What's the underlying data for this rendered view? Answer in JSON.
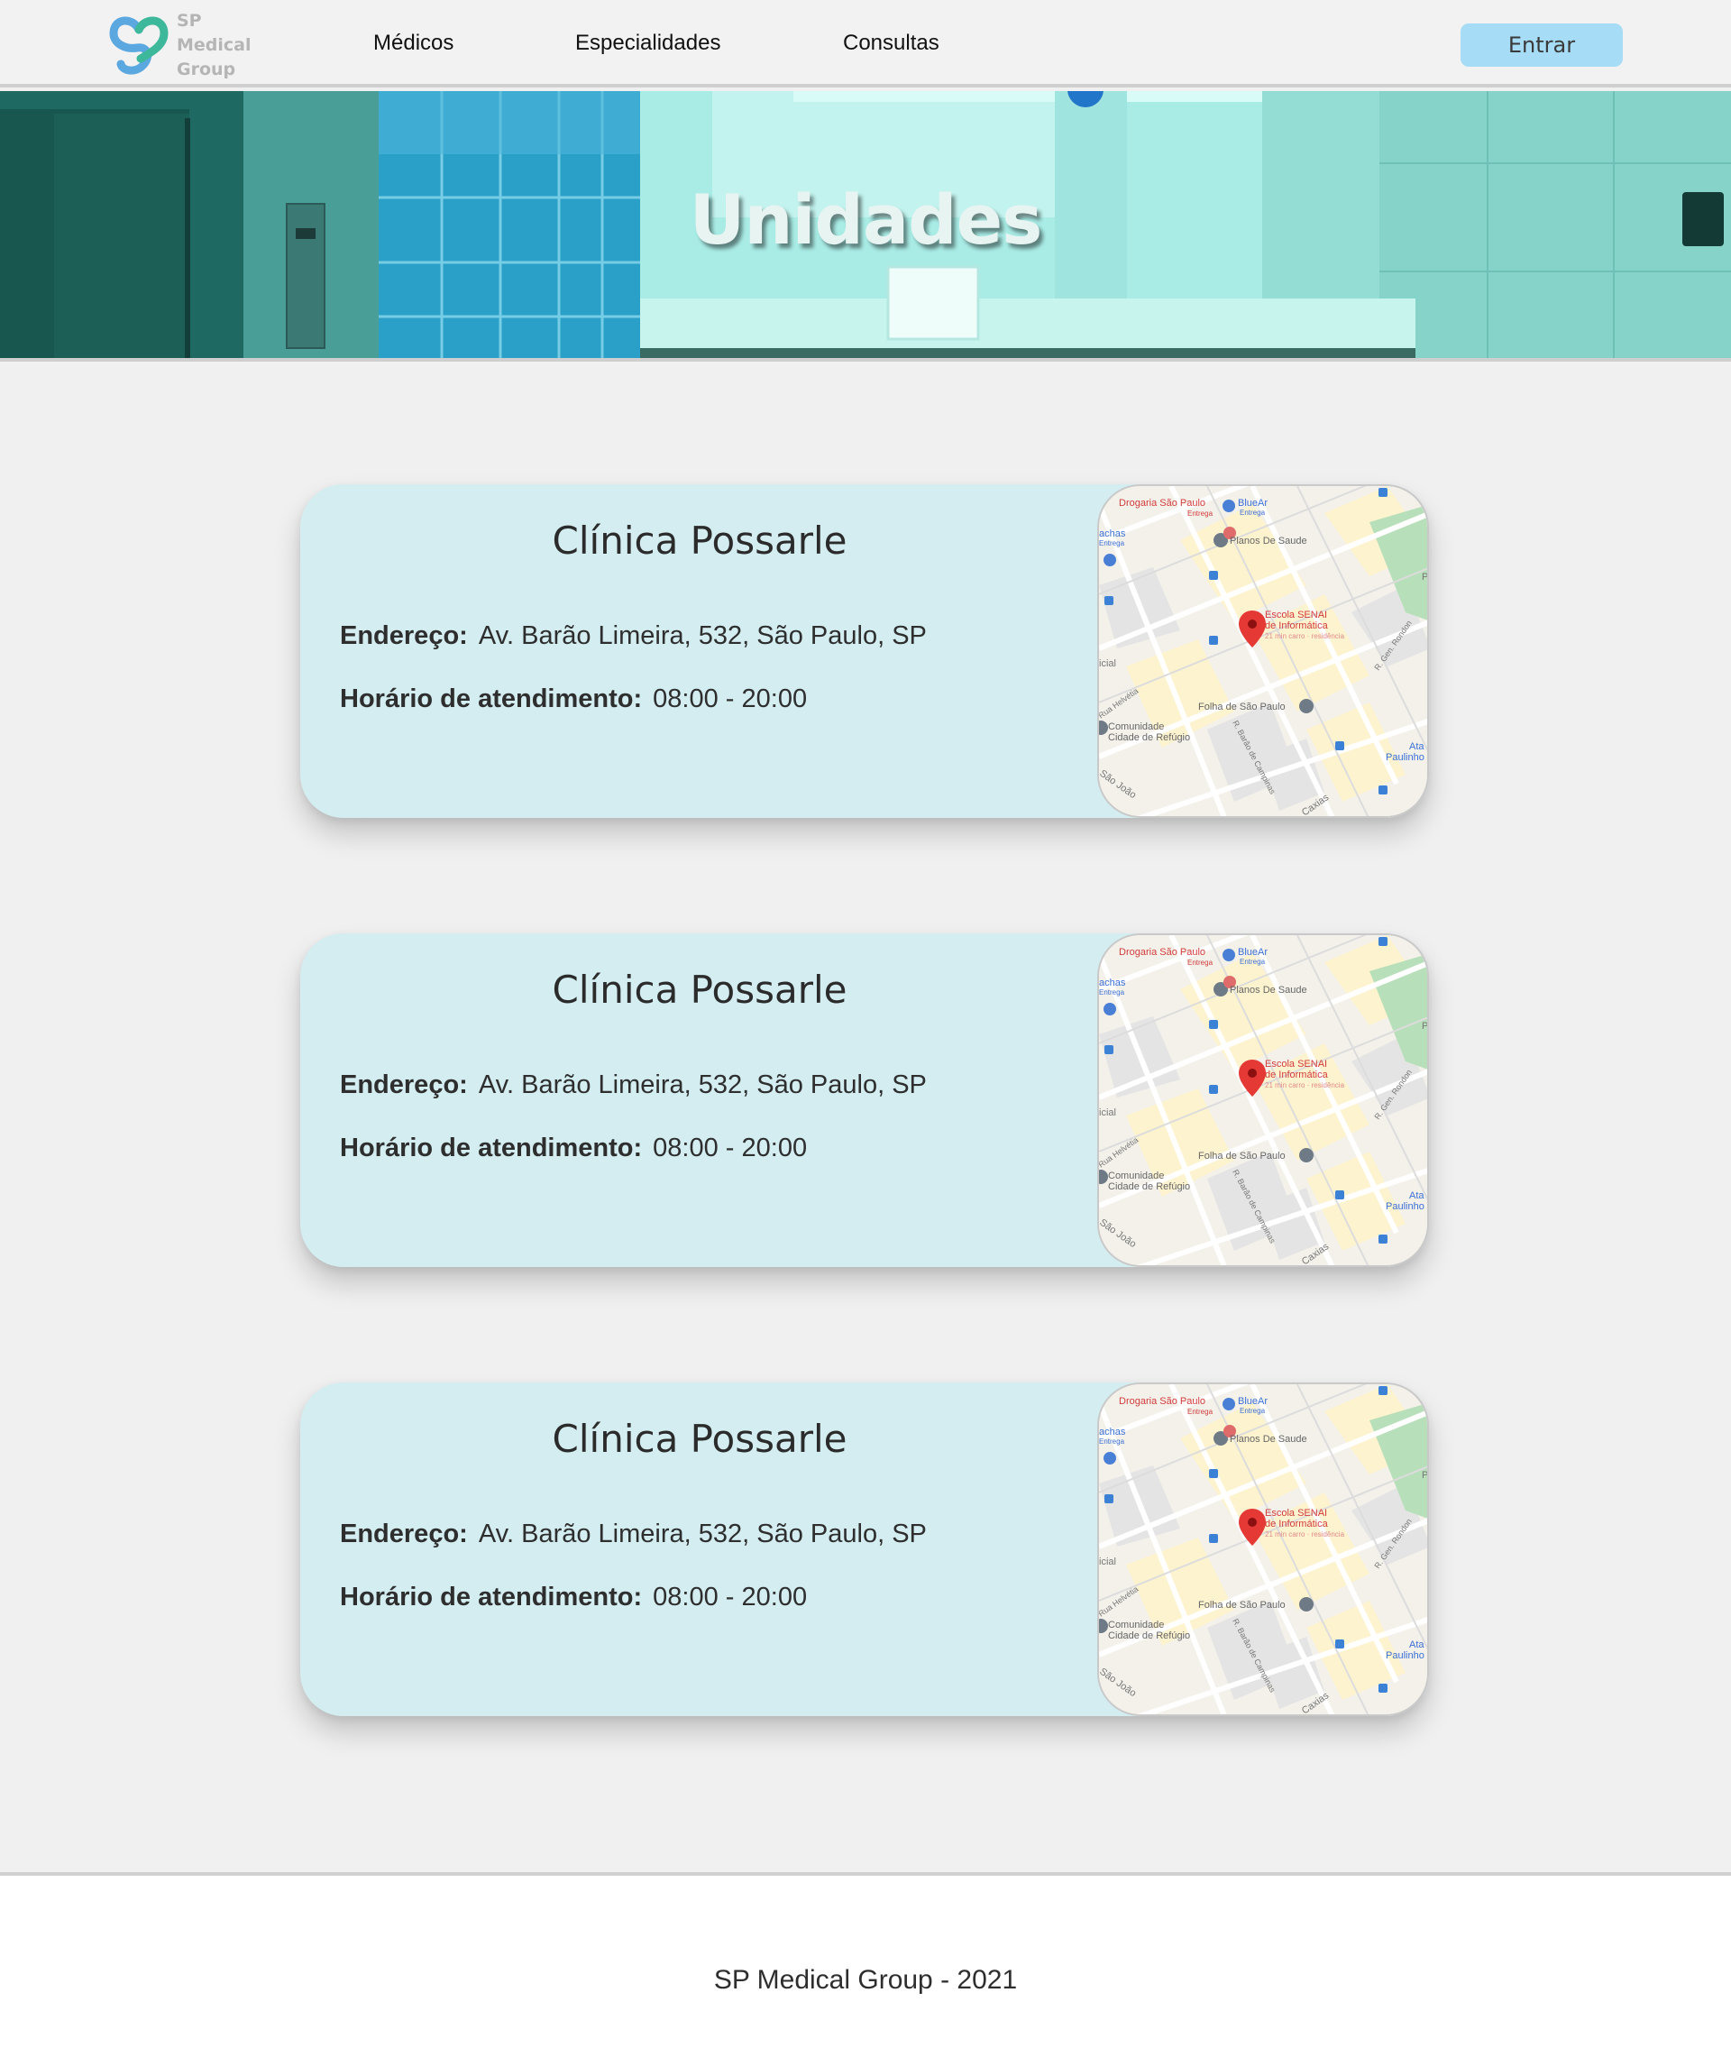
{
  "header": {
    "logo_line1": "SP Medical",
    "logo_line2": "Group",
    "nav": [
      "Médicos",
      "Especialidades",
      "Consultas"
    ],
    "login_label": "Entrar"
  },
  "banner": {
    "title": "Unidades"
  },
  "units": [
    {
      "name": "Clínica Possarle",
      "address_label": "Endereço:",
      "address": "Av. Barão Limeira, 532, São Paulo, SP",
      "hours_label": "Horário de atendimento:",
      "hours": "08:00 - 20:00"
    },
    {
      "name": "Clínica Possarle",
      "address_label": "Endereço:",
      "address": "Av. Barão Limeira, 532, São Paulo, SP",
      "hours_label": "Horário de atendimento:",
      "hours": "08:00 - 20:00"
    },
    {
      "name": "Clínica Possarle",
      "address_label": "Endereço:",
      "address": "Av. Barão Limeira, 532, São Paulo, SP",
      "hours_label": "Horário de atendimento:",
      "hours": "08:00 - 20:00"
    }
  ],
  "map_labels": {
    "drogaria": "Drogaria São Paulo",
    "drogaria_sub": "Entrega",
    "bluear": "BlueAr",
    "bluear_sub": "Entrega",
    "planos": "Planos De Saude",
    "achas": "achas",
    "achas_sub": "Entrega",
    "senai_1": "Escola SENAI",
    "senai_2": "de Informática",
    "senai_sub": "21 min carro · residência",
    "icial": "icial",
    "rua_helvetia": "Rua Helvétia",
    "folha": "Folha de São Paulo",
    "comunidade_1": "Comunidade",
    "comunidade_2": "Cidade de Refúgio",
    "barao_campinas": "R. Barão de Campinas",
    "gen_rondon": "R. Gen. Rondon",
    "sao_joao": "São João",
    "caxias": "Caxias",
    "ata": "Ata",
    "paulinho": "Paulinho",
    "p": "P"
  },
  "colors": {
    "card_bg": "#d3edf1",
    "login_bg": "#a6dcf5",
    "logo_green": "#3db89b",
    "logo_blue": "#5ba8e0",
    "map_pin": "#e53935"
  },
  "footer": {
    "text": "SP Medical Group - 2021"
  }
}
